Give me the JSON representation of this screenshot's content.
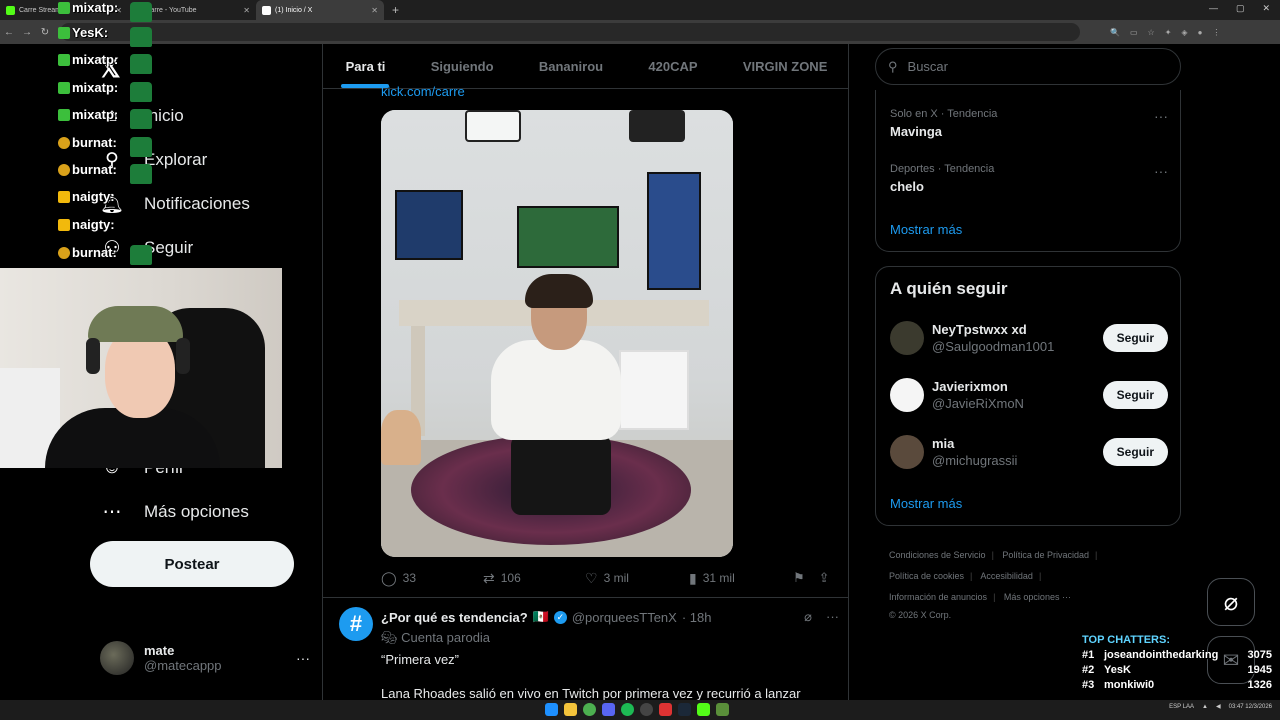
{
  "browser": {
    "tabs": [
      {
        "label": "Carre Stream",
        "favcolor": "#53fc18"
      },
      {
        "label": "carre - YouTube",
        "favcolor": "#ff0000"
      },
      {
        "label": "(1) Inicio / X",
        "favcolor": "#ffffff"
      }
    ]
  },
  "chat_overlay": [
    {
      "user": "mixatp:"
    },
    {
      "user": "YesK:"
    },
    {
      "user": "mixatp:"
    },
    {
      "user": "mixatp:"
    },
    {
      "user": "mixatp:"
    },
    {
      "user": "burnat:"
    },
    {
      "user": "burnat:"
    },
    {
      "user": "naigty:"
    },
    {
      "user": "naigty:"
    },
    {
      "user": "burnat:"
    }
  ],
  "leftnav": {
    "items": [
      {
        "label": "Inicio",
        "icon": "home-icon"
      },
      {
        "label": "Explorar",
        "icon": "search-icon"
      },
      {
        "label": "Notificaciones",
        "icon": "bell-icon"
      },
      {
        "label": "Seguir",
        "icon": "follow-icon"
      },
      {
        "label": "Perfil",
        "icon": "profile-icon"
      },
      {
        "label": "Más opciones",
        "icon": "more-options-icon"
      }
    ],
    "post_label": "Postear",
    "account": {
      "name": "mate",
      "handle": "@matecappp"
    }
  },
  "feed": {
    "tabs": [
      "Para ti",
      "Siguiendo",
      "Bananirou",
      "420CAP",
      "VIRGIN ZONE"
    ],
    "active_tab": "Para ti",
    "tweet1": {
      "link": "kick.com/carre",
      "replies": "33",
      "retweets": "106",
      "likes": "3 mil",
      "views": "31 mil"
    },
    "tweet2": {
      "name": "¿Por qué es tendencia?",
      "flag": "🇲🇽",
      "handle": "@porqueesTTenX",
      "time": "· 18h",
      "parody": "Cuenta parodia",
      "text1": "“Primera vez”",
      "text2": "Lana Rhoades salió en vivo en Twitch por primera vez y recurrió a lanzar"
    }
  },
  "sidebar": {
    "search_placeholder": "Buscar",
    "trends": [
      {
        "meta": "Solo en X · Tendencia",
        "name": "Mavinga"
      },
      {
        "meta": "Deportes · Tendencia",
        "name": "chelo"
      }
    ],
    "show_more": "Mostrar más",
    "who_to_follow": {
      "title": "A quién seguir",
      "users": [
        {
          "name": "NeyTpstwxx xd",
          "handle": "@Saulgoodman1001",
          "avatar_color": "#3b3a2e"
        },
        {
          "name": "Javierixmon",
          "handle": "@JavieRiXmoN",
          "avatar_color": "#f5f5f5"
        },
        {
          "name": "mia",
          "handle": "@michugrassii",
          "avatar_color": "#5a4a3c"
        }
      ],
      "follow_label": "Seguir",
      "show_more": "Mostrar más"
    },
    "footer": [
      "Condiciones de Servicio",
      "Política de Privacidad",
      "Política de cookies",
      "Accesibilidad",
      "Información de anuncios",
      "Más opciones ···",
      "© 2026 X Corp."
    ]
  },
  "top_chatters": {
    "title": "TOP CHATTERS:",
    "list": [
      {
        "rank": "#1",
        "name": "joseandointhedarking",
        "count": "3075"
      },
      {
        "rank": "#2",
        "name": "YesK",
        "count": "1945"
      },
      {
        "rank": "#3",
        "name": "monkiwi0",
        "count": "1326"
      }
    ]
  },
  "taskbar": {
    "lang": "ESP LAA",
    "time": "03:47",
    "date": "12/3/2026"
  }
}
